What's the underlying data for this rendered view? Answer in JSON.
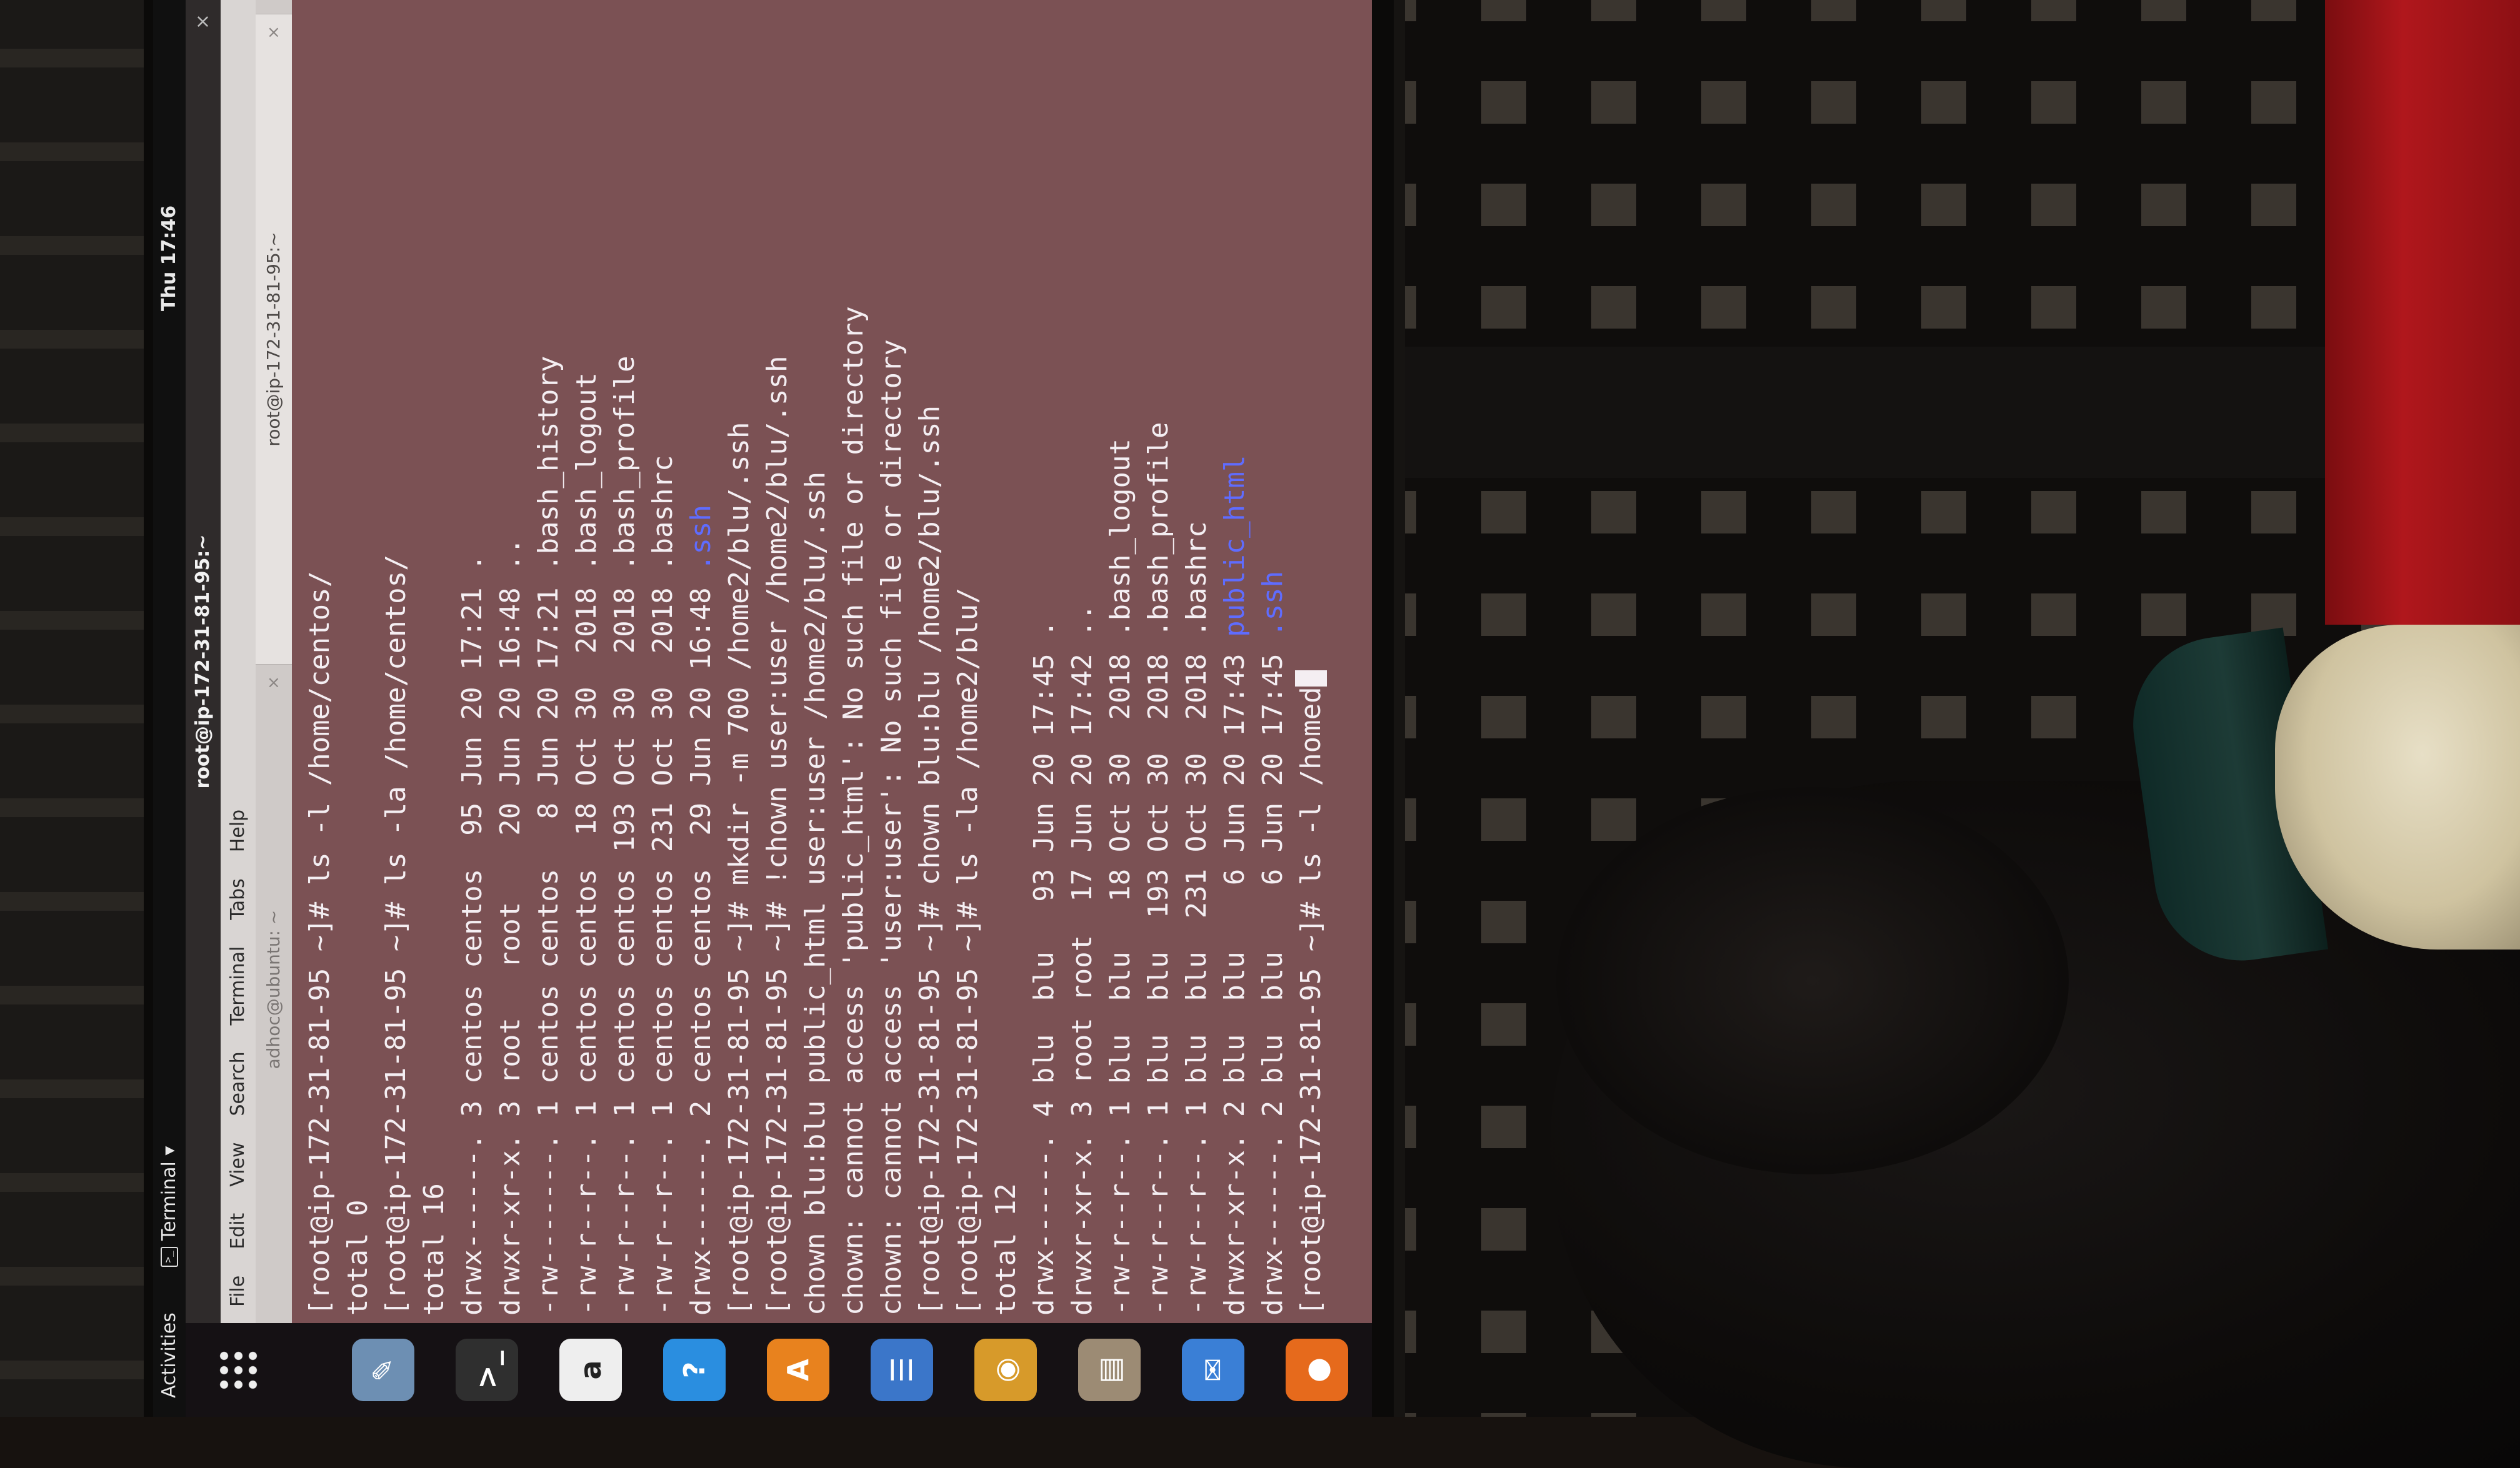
{
  "topbar": {
    "activities": "Activities",
    "app_menu": "Terminal ▾",
    "clock": "Thu 17:46"
  },
  "dock": {
    "items": [
      "firefox-icon",
      "thunderbird-icon",
      "files-icon",
      "rhythmbox-icon",
      "libreoffice-writer-icon",
      "software-center-icon",
      "help-icon",
      "amazon-icon",
      "terminal-icon",
      "editor-icon",
      "show-applications-icon"
    ]
  },
  "terminal": {
    "window_title": "root@ip-172-31-81-95:~",
    "close": "×",
    "menu": [
      "File",
      "Edit",
      "View",
      "Search",
      "Terminal",
      "Tabs",
      "Help"
    ],
    "tabs": [
      {
        "label": "adhoc@ubuntu: ~",
        "close": "×"
      },
      {
        "label": "root@ip-172-31-81-95:~",
        "close": "×"
      }
    ],
    "lines": [
      {
        "text": "[root@ip-172-31-81-95 ~]# ls -l /home/centos/"
      },
      {
        "text": "total 0"
      },
      {
        "text": "[root@ip-172-31-81-95 ~]# ls -la /home/centos/"
      },
      {
        "text": "total 16"
      },
      {
        "text": "drwx------. 3 centos centos  95 Jun 20 17:21 ."
      },
      {
        "text": "drwxr-xr-x. 3 root   root    20 Jun 20 16:48 .."
      },
      {
        "text": "-rw-------. 1 centos centos   8 Jun 20 17:21 .bash_history"
      },
      {
        "text": "-rw-r--r--. 1 centos centos  18 Oct 30  2018 .bash_logout"
      },
      {
        "text": "-rw-r--r--. 1 centos centos 193 Oct 30  2018 .bash_profile"
      },
      {
        "text": "-rw-r--r--. 1 centos centos 231 Oct 30  2018 .bashrc"
      },
      {
        "text": "drwx------. 2 centos centos  29 Jun 20 16:48 ",
        "dir": ".ssh"
      },
      {
        "text": "[root@ip-172-31-81-95 ~]# mkdir -m 700 /home2/blu/.ssh"
      },
      {
        "text": "[root@ip-172-31-81-95 ~]# !chown user:user /home2/blu/.ssh"
      },
      {
        "text": "chown blu:blu public_html user:user /home2/blu/.ssh"
      },
      {
        "text": "chown: cannot access 'public_html': No such file or directory"
      },
      {
        "text": "chown: cannot access 'user:user': No such file or directory"
      },
      {
        "text": "[root@ip-172-31-81-95 ~]# chown blu:blu /home2/blu/.ssh"
      },
      {
        "text": "[root@ip-172-31-81-95 ~]# ls -la /home2/blu/"
      },
      {
        "text": "total 12"
      },
      {
        "text": "drwx------. 4 blu  blu   93 Jun 20 17:45 ."
      },
      {
        "text": "drwxr-xr-x. 3 root root  17 Jun 20 17:42 .."
      },
      {
        "text": "-rw-r--r--. 1 blu  blu   18 Oct 30  2018 .bash_logout"
      },
      {
        "text": "-rw-r--r--. 1 blu  blu  193 Oct 30  2018 .bash_profile"
      },
      {
        "text": "-rw-r--r--. 1 blu  blu  231 Oct 30  2018 .bashrc"
      },
      {
        "text": "drwxr-xr-x. 2 blu  blu    6 Jun 20 17:43 ",
        "dir": "public_html"
      },
      {
        "text": "drwx------. 2 blu  blu    6 Jun 20 17:45 ",
        "dir": ".ssh"
      },
      {
        "text": "[root@ip-172-31-81-95 ~]# ls -l /homed",
        "cursor": " "
      }
    ]
  },
  "colors": {
    "terminal_bg": "#7b5154",
    "terminal_fg": "#f4eef2",
    "directory": "#5f6cff",
    "topbar": "#101010"
  }
}
